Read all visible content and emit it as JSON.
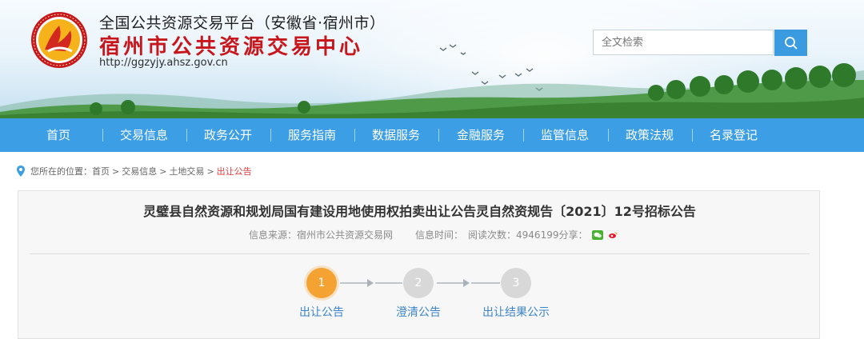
{
  "header": {
    "platform_name": "全国公共资源交易平台（安徽省·宿州市）",
    "center_name": "宿州市公共资源交易中心",
    "url": "http://ggzyjy.ahsz.gov.cn",
    "logo_icon": "public-resource-logo-icon",
    "search": {
      "placeholder": "全文检索",
      "button_icon": "search-icon"
    }
  },
  "nav": {
    "items": [
      {
        "label": "首页"
      },
      {
        "label": "交易信息"
      },
      {
        "label": "政务公开"
      },
      {
        "label": "服务指南"
      },
      {
        "label": "数据服务"
      },
      {
        "label": "金融服务"
      },
      {
        "label": "监管信息"
      },
      {
        "label": "政策法规"
      },
      {
        "label": "名录登记"
      }
    ]
  },
  "breadcrumb": {
    "prefix": "您所在的位置：",
    "items": [
      "首页",
      "交易信息",
      "土地交易"
    ],
    "current": "出让公告",
    "separator": ">"
  },
  "article": {
    "title": "灵璧县自然资源和规划局国有建设用地使用权拍卖出让公告灵自然资规告〔2021〕12号招标公告",
    "source": "信息来源：宿州市公共资源交易网",
    "time": "信息时间：",
    "views": "阅读次数：4946199",
    "share_label": "分享：",
    "share_icons": [
      "wechat-share-icon",
      "weibo-share-icon"
    ]
  },
  "steps": [
    {
      "number": "1",
      "label": "出让公告",
      "state": "active"
    },
    {
      "number": "2",
      "label": "澄清公告",
      "state": "idle"
    },
    {
      "number": "3",
      "label": "出让结果公示",
      "state": "idle"
    }
  ],
  "colors": {
    "nav_bg": "#3c9ee4",
    "center_name": "#c8161d",
    "step_active": "#f4a232",
    "step_idle": "#d8d8d8",
    "step_label": "#3c84c8",
    "breadcrumb_current": "#e4393c"
  }
}
